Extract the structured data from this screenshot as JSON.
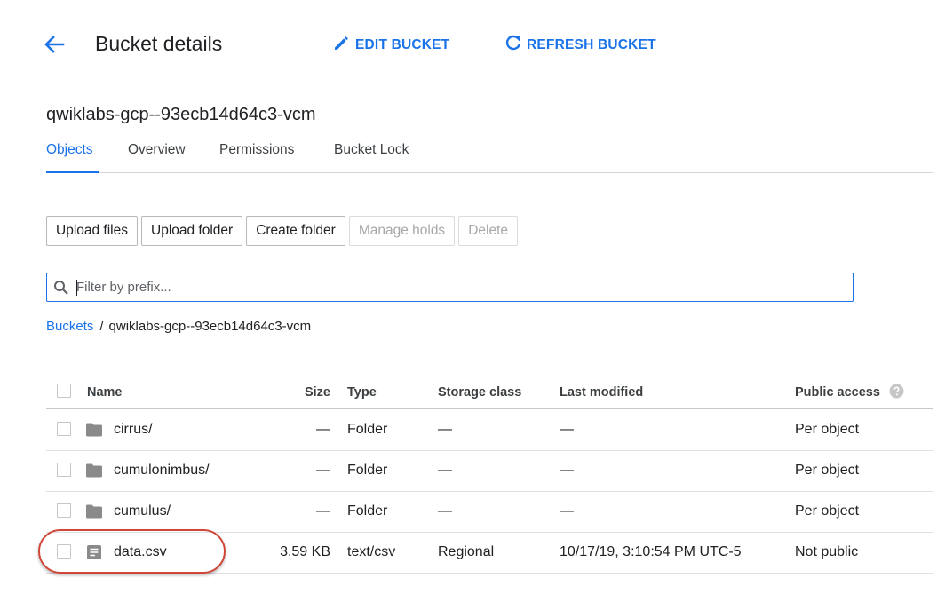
{
  "header": {
    "title": "Bucket details",
    "edit_label": "EDIT BUCKET",
    "refresh_label": "REFRESH BUCKET"
  },
  "bucket": {
    "name": "qwiklabs-gcp--93ecb14d64c3-vcm"
  },
  "tabs": [
    {
      "label": "Objects",
      "active": true
    },
    {
      "label": "Overview",
      "active": false
    },
    {
      "label": "Permissions",
      "active": false
    },
    {
      "label": "Bucket Lock",
      "active": false
    }
  ],
  "actions": {
    "upload_files": "Upload files",
    "upload_folder": "Upload folder",
    "create_folder": "Create folder",
    "manage_holds": "Manage holds",
    "delete": "Delete"
  },
  "filter": {
    "placeholder": "Filter by prefix...",
    "value": ""
  },
  "breadcrumb": {
    "root": "Buckets",
    "separator": "/",
    "current": "qwiklabs-gcp--93ecb14d64c3-vcm"
  },
  "table": {
    "columns": {
      "name": "Name",
      "size": "Size",
      "type": "Type",
      "storage_class": "Storage class",
      "last_modified": "Last modified",
      "public_access": "Public access"
    },
    "rows": [
      {
        "icon": "folder-icon",
        "name": "cirrus/",
        "size": "—",
        "type": "Folder",
        "storage_class": "—",
        "last_modified": "—",
        "public_access": "Per object"
      },
      {
        "icon": "folder-icon",
        "name": "cumulonimbus/",
        "size": "—",
        "type": "Folder",
        "storage_class": "—",
        "last_modified": "—",
        "public_access": "Per object"
      },
      {
        "icon": "folder-icon",
        "name": "cumulus/",
        "size": "—",
        "type": "Folder",
        "storage_class": "—",
        "last_modified": "—",
        "public_access": "Per object"
      },
      {
        "icon": "file-icon",
        "name": "data.csv",
        "size": "3.59 KB",
        "type": "text/csv",
        "storage_class": "Regional",
        "last_modified": "10/17/19, 3:10:54 PM UTC-5",
        "public_access": "Not public"
      }
    ]
  },
  "colors": {
    "accent": "#1a73e8",
    "highlight": "#d0473a"
  }
}
